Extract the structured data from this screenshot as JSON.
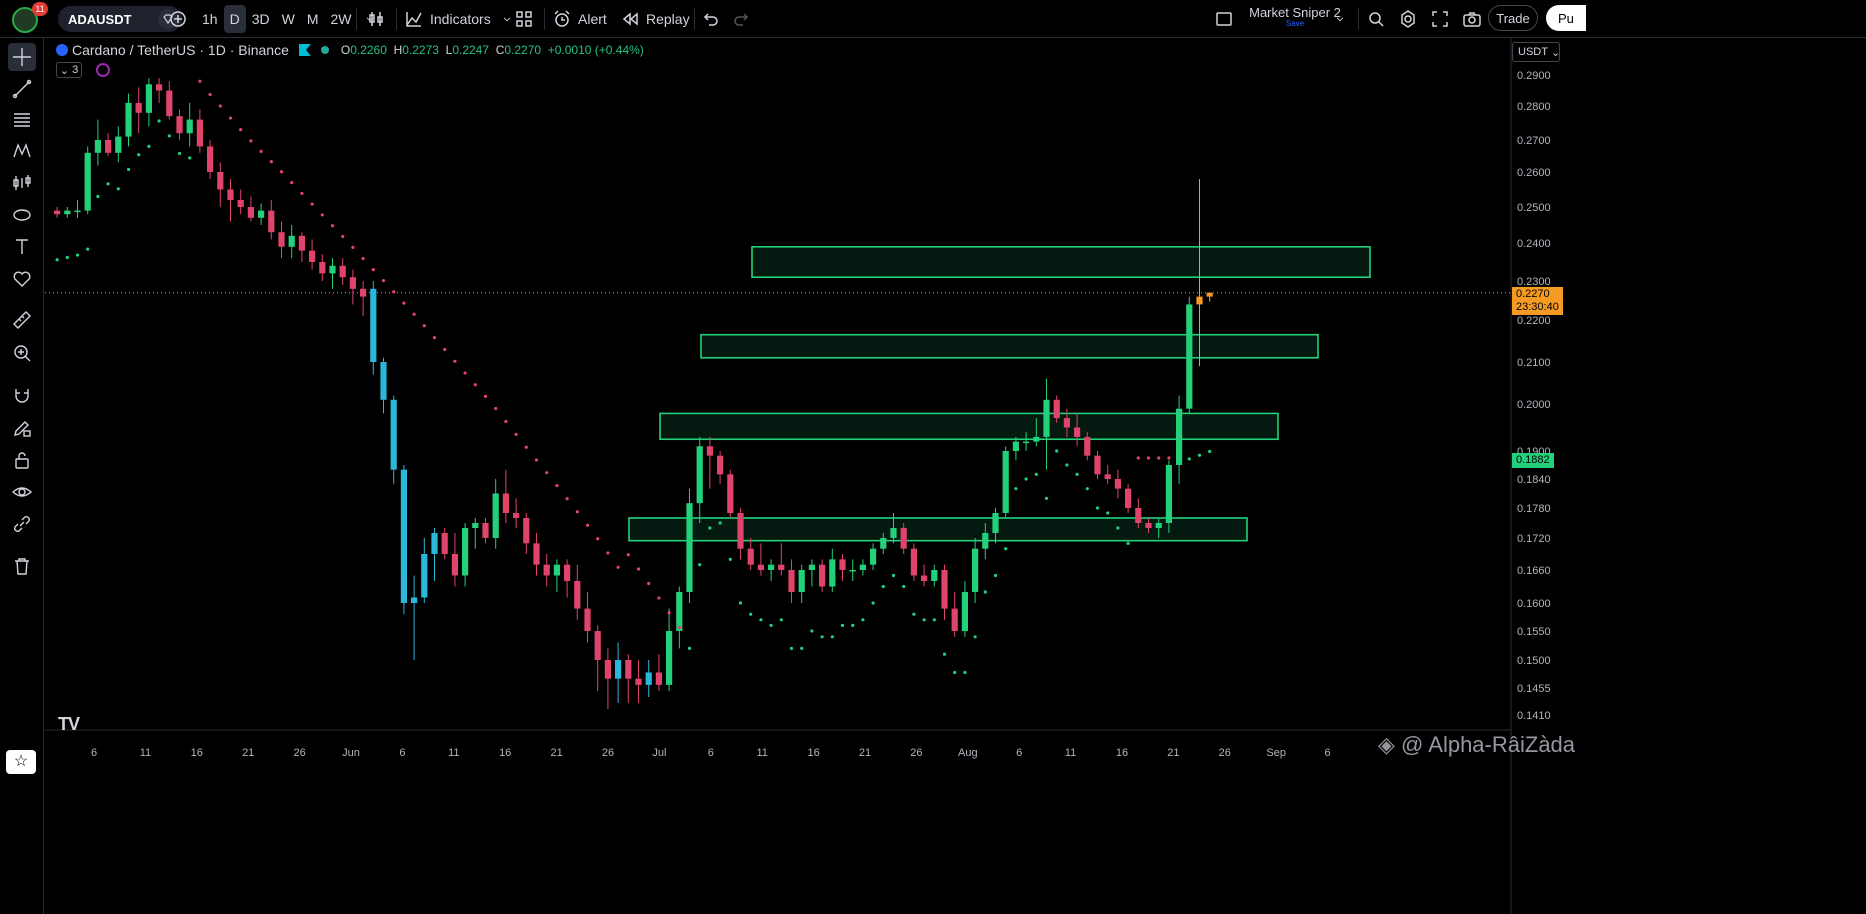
{
  "toolbar": {
    "notifications": "11",
    "symbol": "ADAUSDT",
    "intervals": [
      "1h",
      "D",
      "3D",
      "W",
      "M",
      "2W"
    ],
    "active_interval": "D",
    "indicators_label": "Indicators",
    "alert_label": "Alert",
    "replay_label": "Replay",
    "layout_name": "Market Sniper 2",
    "layout_status": "Save",
    "trade_label": "Trade",
    "publish_label": "Pu"
  },
  "legend": {
    "title": "Cardano / TetherUS · 1D · Binance",
    "open_label": "O",
    "open": "0.2260",
    "high_label": "H",
    "high": "0.2273",
    "low_label": "L",
    "low": "0.2247",
    "close_label": "C",
    "close": "0.2270",
    "change": "+0.0010 (+0.44%)",
    "indicator_count": "3"
  },
  "price_scale": {
    "currency": "USDT",
    "current_price": "0.2270",
    "countdown": "23:30:40",
    "psar_value": "0.1882"
  },
  "watermark": "@ Alpha-RâiZàda",
  "colors": {
    "up": "#22d17a",
    "down": "#e0446a",
    "highlight_up": "#2bb7d9",
    "last_candle": "#f59b23",
    "zone": "#22d17a",
    "psar_bull": "#22d17a",
    "psar_bear": "#e0446a"
  },
  "chart_data": {
    "type": "candlestick",
    "y_ticks": [
      "0.2900",
      "0.2800",
      "0.2700",
      "0.2600",
      "0.2500",
      "0.2400",
      "0.2300",
      "0.2200",
      "0.2100",
      "0.2000",
      "0.1900",
      "0.1840",
      "0.1780",
      "0.1720",
      "0.1660",
      "0.1600",
      "0.1550",
      "0.1500",
      "0.1455",
      "0.1410"
    ],
    "x_ticks": [
      "6",
      "11",
      "16",
      "21",
      "26",
      "Jun",
      "6",
      "11",
      "16",
      "21",
      "26",
      "Jul",
      "6",
      "11",
      "16",
      "21",
      "26",
      "Aug",
      "6",
      "11",
      "16",
      "21",
      "26",
      "Sep",
      "6"
    ],
    "zones": [
      {
        "low": 0.231,
        "high": 0.239
      },
      {
        "low": 0.211,
        "high": 0.2165
      },
      {
        "low": 0.1925,
        "high": 0.198
      },
      {
        "low": 0.1715,
        "high": 0.176
      }
    ],
    "candles": [
      [
        0.249,
        0.25,
        0.247,
        0.248
      ],
      [
        0.248,
        0.25,
        0.247,
        0.249
      ],
      [
        0.249,
        0.252,
        0.247,
        0.249
      ],
      [
        0.249,
        0.268,
        0.248,
        0.266
      ],
      [
        0.266,
        0.276,
        0.262,
        0.27
      ],
      [
        0.27,
        0.272,
        0.265,
        0.266
      ],
      [
        0.266,
        0.274,
        0.263,
        0.271
      ],
      [
        0.271,
        0.284,
        0.268,
        0.281
      ],
      [
        0.281,
        0.286,
        0.272,
        0.278
      ],
      [
        0.278,
        0.289,
        0.274,
        0.287
      ],
      [
        0.287,
        0.289,
        0.281,
        0.285
      ],
      [
        0.285,
        0.288,
        0.276,
        0.277
      ],
      [
        0.277,
        0.279,
        0.27,
        0.272
      ],
      [
        0.272,
        0.281,
        0.268,
        0.276
      ],
      [
        0.276,
        0.279,
        0.266,
        0.268
      ],
      [
        0.268,
        0.27,
        0.258,
        0.26
      ],
      [
        0.26,
        0.263,
        0.25,
        0.255
      ],
      [
        0.255,
        0.258,
        0.246,
        0.252
      ],
      [
        0.252,
        0.255,
        0.248,
        0.25
      ],
      [
        0.25,
        0.253,
        0.246,
        0.247
      ],
      [
        0.247,
        0.251,
        0.245,
        0.249
      ],
      [
        0.249,
        0.252,
        0.241,
        0.243
      ],
      [
        0.243,
        0.246,
        0.236,
        0.239
      ],
      [
        0.239,
        0.245,
        0.236,
        0.242
      ],
      [
        0.242,
        0.243,
        0.235,
        0.238
      ],
      [
        0.238,
        0.241,
        0.233,
        0.235
      ],
      [
        0.235,
        0.237,
        0.23,
        0.232
      ],
      [
        0.232,
        0.236,
        0.228,
        0.234
      ],
      [
        0.234,
        0.236,
        0.229,
        0.231
      ],
      [
        0.231,
        0.233,
        0.224,
        0.228
      ],
      [
        0.228,
        0.23,
        0.221,
        0.226
      ],
      [
        0.228,
        0.23,
        0.207,
        0.21
      ],
      [
        0.21,
        0.211,
        0.198,
        0.201
      ],
      [
        0.201,
        0.202,
        0.183,
        0.186
      ],
      [
        0.186,
        0.187,
        0.158,
        0.16
      ],
      [
        0.16,
        0.165,
        0.15,
        0.161
      ],
      [
        0.161,
        0.172,
        0.16,
        0.169
      ],
      [
        0.169,
        0.174,
        0.164,
        0.173
      ],
      [
        0.173,
        0.174,
        0.168,
        0.169
      ],
      [
        0.169,
        0.173,
        0.163,
        0.165
      ],
      [
        0.165,
        0.175,
        0.163,
        0.174
      ],
      [
        0.174,
        0.176,
        0.17,
        0.175
      ],
      [
        0.175,
        0.176,
        0.171,
        0.172
      ],
      [
        0.172,
        0.184,
        0.17,
        0.181
      ],
      [
        0.181,
        0.186,
        0.175,
        0.177
      ],
      [
        0.177,
        0.18,
        0.174,
        0.176
      ],
      [
        0.176,
        0.177,
        0.169,
        0.171
      ],
      [
        0.171,
        0.173,
        0.165,
        0.167
      ],
      [
        0.167,
        0.169,
        0.163,
        0.165
      ],
      [
        0.165,
        0.168,
        0.162,
        0.167
      ],
      [
        0.167,
        0.168,
        0.161,
        0.164
      ],
      [
        0.164,
        0.167,
        0.157,
        0.159
      ],
      [
        0.159,
        0.162,
        0.153,
        0.155
      ],
      [
        0.155,
        0.156,
        0.145,
        0.15
      ],
      [
        0.15,
        0.152,
        0.142,
        0.147
      ],
      [
        0.147,
        0.153,
        0.143,
        0.15
      ],
      [
        0.15,
        0.151,
        0.143,
        0.147
      ],
      [
        0.147,
        0.15,
        0.143,
        0.146
      ],
      [
        0.146,
        0.15,
        0.144,
        0.148
      ],
      [
        0.148,
        0.151,
        0.145,
        0.146
      ],
      [
        0.146,
        0.159,
        0.145,
        0.155
      ],
      [
        0.155,
        0.163,
        0.152,
        0.162
      ],
      [
        0.162,
        0.182,
        0.16,
        0.179
      ],
      [
        0.179,
        0.193,
        0.175,
        0.191
      ],
      [
        0.191,
        0.193,
        0.182,
        0.189
      ],
      [
        0.189,
        0.19,
        0.183,
        0.185
      ],
      [
        0.185,
        0.186,
        0.176,
        0.177
      ],
      [
        0.177,
        0.178,
        0.168,
        0.17
      ],
      [
        0.17,
        0.172,
        0.166,
        0.167
      ],
      [
        0.167,
        0.171,
        0.165,
        0.166
      ],
      [
        0.166,
        0.168,
        0.164,
        0.167
      ],
      [
        0.167,
        0.171,
        0.165,
        0.166
      ],
      [
        0.166,
        0.168,
        0.16,
        0.162
      ],
      [
        0.162,
        0.167,
        0.16,
        0.166
      ],
      [
        0.166,
        0.168,
        0.163,
        0.167
      ],
      [
        0.167,
        0.168,
        0.162,
        0.163
      ],
      [
        0.163,
        0.17,
        0.162,
        0.168
      ],
      [
        0.168,
        0.169,
        0.164,
        0.166
      ],
      [
        0.166,
        0.168,
        0.164,
        0.166
      ],
      [
        0.166,
        0.168,
        0.165,
        0.167
      ],
      [
        0.167,
        0.171,
        0.166,
        0.17
      ],
      [
        0.17,
        0.173,
        0.169,
        0.172
      ],
      [
        0.172,
        0.177,
        0.171,
        0.174
      ],
      [
        0.174,
        0.175,
        0.169,
        0.17
      ],
      [
        0.17,
        0.171,
        0.164,
        0.165
      ],
      [
        0.165,
        0.167,
        0.163,
        0.164
      ],
      [
        0.164,
        0.167,
        0.163,
        0.166
      ],
      [
        0.166,
        0.167,
        0.157,
        0.159
      ],
      [
        0.159,
        0.162,
        0.154,
        0.155
      ],
      [
        0.155,
        0.164,
        0.154,
        0.162
      ],
      [
        0.162,
        0.172,
        0.16,
        0.17
      ],
      [
        0.17,
        0.175,
        0.168,
        0.173
      ],
      [
        0.173,
        0.178,
        0.171,
        0.177
      ],
      [
        0.177,
        0.191,
        0.176,
        0.19
      ],
      [
        0.19,
        0.193,
        0.188,
        0.192
      ],
      [
        0.192,
        0.194,
        0.19,
        0.192
      ],
      [
        0.192,
        0.197,
        0.191,
        0.193
      ],
      [
        0.193,
        0.206,
        0.186,
        0.201
      ],
      [
        0.201,
        0.202,
        0.196,
        0.197
      ],
      [
        0.197,
        0.199,
        0.193,
        0.195
      ],
      [
        0.195,
        0.198,
        0.191,
        0.193
      ],
      [
        0.193,
        0.194,
        0.188,
        0.189
      ],
      [
        0.189,
        0.19,
        0.184,
        0.185
      ],
      [
        0.185,
        0.187,
        0.183,
        0.184
      ],
      [
        0.184,
        0.186,
        0.18,
        0.182
      ],
      [
        0.182,
        0.183,
        0.177,
        0.178
      ],
      [
        0.178,
        0.18,
        0.174,
        0.175
      ],
      [
        0.175,
        0.176,
        0.173,
        0.174
      ],
      [
        0.174,
        0.176,
        0.172,
        0.175
      ],
      [
        0.175,
        0.188,
        0.173,
        0.187
      ],
      [
        0.187,
        0.202,
        0.183,
        0.199
      ],
      [
        0.199,
        0.226,
        0.198,
        0.224
      ],
      [
        0.224,
        0.258,
        0.209,
        0.226
      ],
      [
        0.226,
        0.227,
        0.2247,
        0.227
      ]
    ]
  }
}
